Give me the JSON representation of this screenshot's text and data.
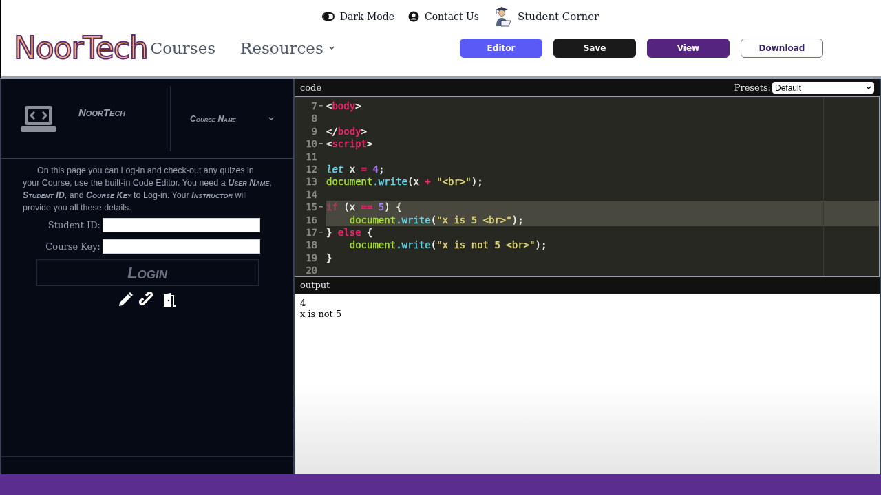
{
  "top_links": [
    {
      "kind": "toggle",
      "label": "Dark Mode"
    },
    {
      "kind": "contact",
      "label": "Contact Us"
    },
    {
      "kind": "student",
      "label": "Student Corner"
    }
  ],
  "logo": "NoorTech",
  "nav": [
    {
      "label": "Courses",
      "dropdown": false
    },
    {
      "label": "Resources",
      "dropdown": true
    }
  ],
  "buttons": [
    {
      "label": "Editor",
      "kind": "primary"
    },
    {
      "label": "Save",
      "kind": "dark"
    },
    {
      "label": "View",
      "kind": "purple"
    },
    {
      "label": "Download",
      "kind": "outline"
    }
  ],
  "sidebar": {
    "brand": "NoorTech",
    "course_select": "Course Name",
    "intro": "On this page you can Log-in and check-out any quizes in your Course, use the built-in Code Editor. You need a **User Name**, **Student ID**, and **Course Key** to Log-in. Your **Instructor** will provide you all these details.",
    "fields": [
      {
        "label": "Student ID:"
      },
      {
        "label": "Course Key:"
      }
    ],
    "login": "Login"
  },
  "editor": {
    "title": "code",
    "presets_label": "Presets:",
    "preset": "Default",
    "lines": [
      {
        "n": "7",
        "fold": true,
        "selected": false,
        "tokens": [
          {
            "t": "<",
            "color": "#f8f8f2"
          },
          {
            "t": "body",
            "color": "#f92672"
          },
          {
            "t": ">",
            "color": "#f8f8f2"
          }
        ]
      },
      {
        "n": "8",
        "fold": false,
        "selected": false
      },
      {
        "n": "9",
        "fold": false,
        "selected": false,
        "tokens": [
          {
            "t": "</",
            "color": "#f8f8f2"
          },
          {
            "t": "body",
            "color": "#f92672"
          },
          {
            "t": ">",
            "color": "#f8f8f2"
          }
        ]
      },
      {
        "n": "10",
        "fold": true,
        "selected": false,
        "tokens": [
          {
            "t": "<",
            "color": "#f8f8f2"
          },
          {
            "t": "script",
            "color": "#f92672"
          },
          {
            "t": ">",
            "color": "#f8f8f2"
          }
        ]
      },
      {
        "n": "11",
        "fold": false,
        "selected": false
      },
      {
        "n": "12",
        "fold": false,
        "selected": false,
        "tokens": [
          {
            "t": "let",
            "color": "#66d9ef",
            "italic": true
          },
          {
            "t": " x ",
            "color": "#f8f8f2"
          },
          {
            "t": "=",
            "color": "#f92672"
          },
          {
            "t": " 4",
            "color": "#ae81ff"
          },
          {
            "t": ";",
            "color": "#f8f8f2"
          }
        ]
      },
      {
        "n": "13",
        "fold": false,
        "selected": false,
        "tokens": [
          {
            "t": "document",
            "color": "#a6e22e"
          },
          {
            "t": ".write",
            "color": "#66d9ef"
          },
          {
            "t": "(x ",
            "color": "#f8f8f2"
          },
          {
            "t": "+",
            "color": "#f92672"
          },
          {
            "t": " \"<br>\"",
            "color": "#e6db74"
          },
          {
            "t": ");",
            "color": "#f8f8f2"
          }
        ]
      },
      {
        "n": "14",
        "fold": false,
        "selected": false
      },
      {
        "n": "15",
        "fold": true,
        "selected": true,
        "tokens": [
          {
            "t": "if"
          },
          {
            "t": " (x ",
            "color": "#f8f8f2"
          },
          {
            "t": "==",
            "color": "#f92672"
          },
          {
            "t": " 5",
            "color": "#ae81ff"
          },
          {
            "t": ") {",
            "color": "#f8f8f2"
          }
        ]
      },
      {
        "n": "16",
        "fold": false,
        "selected": true,
        "indented": true,
        "tokens": [
          {
            "t": "document",
            "color": "#a6e22e"
          },
          {
            "t": ".write",
            "color": "#66d9ef"
          },
          {
            "t": "(",
            "color": "#f8f8f2"
          },
          {
            "t": "\"x is 5 <br>\"",
            "color": "#e6db74"
          },
          {
            "t": ");",
            "color": "#f8f8f2"
          }
        ]
      },
      {
        "n": "17",
        "fold": true,
        "selected": false,
        "tokens": [
          {
            "t": "}",
            "color": "#f8f8f2"
          },
          {
            "t": " else",
            "color": "#f92672"
          },
          {
            "t": " {",
            "color": "#f8f8f2"
          }
        ]
      },
      {
        "n": "18",
        "fold": false,
        "selected": false,
        "indented": true,
        "tokens": [
          {
            "t": "document",
            "color": "#a6e22e"
          },
          {
            "t": ".write",
            "color": "#66d9ef"
          },
          {
            "t": "(",
            "color": "#f8f8f2"
          },
          {
            "t": "\"x is not 5 <br>\"",
            "color": "#e6db74"
          },
          {
            "t": ");",
            "color": "#f8f8f2"
          }
        ]
      },
      {
        "n": "19",
        "fold": false,
        "selected": false,
        "tokens": [
          {
            "t": "}",
            "color": "#f8f8f2"
          }
        ]
      },
      {
        "n": "20",
        "fold": false,
        "selected": false
      }
    ]
  },
  "output": {
    "title": "output",
    "lines": [
      "4",
      "x is not 5"
    ]
  }
}
